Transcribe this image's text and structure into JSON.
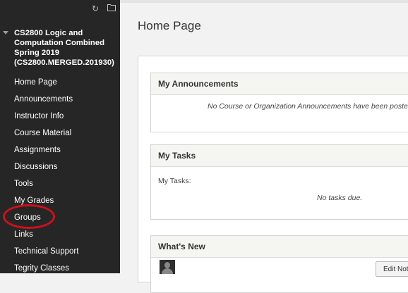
{
  "sidebar": {
    "course_title": "CS2800 Logic and\nComputation Combined\nSpring 2019\n(CS2800.MERGED.201930)",
    "tools": {
      "refresh_icon": "refresh-icon",
      "folder_icon": "folder-icon"
    },
    "items": [
      {
        "label": "Home Page"
      },
      {
        "label": "Announcements"
      },
      {
        "label": "Instructor Info"
      },
      {
        "label": "Course Material"
      },
      {
        "label": "Assignments"
      },
      {
        "label": "Discussions"
      },
      {
        "label": "Tools"
      },
      {
        "label": "My Grades"
      },
      {
        "label": "Groups"
      },
      {
        "label": "Links"
      },
      {
        "label": "Technical Support"
      },
      {
        "label": "Tegrity Classes"
      }
    ]
  },
  "main": {
    "page_title": "Home Page",
    "modules": {
      "announcements": {
        "title": "My Announcements",
        "empty_text": "No Course or Organization Announcements have been posted"
      },
      "tasks": {
        "title": "My Tasks",
        "label": "My Tasks:",
        "empty_text": "No tasks due."
      },
      "whats_new": {
        "title": "What's New",
        "edit_button": "Edit Notification Settings"
      }
    }
  },
  "colors": {
    "sidebar_bg": "#262626",
    "highlight_ring": "#d0101a",
    "module_header_bg": "#f5f5f2"
  }
}
